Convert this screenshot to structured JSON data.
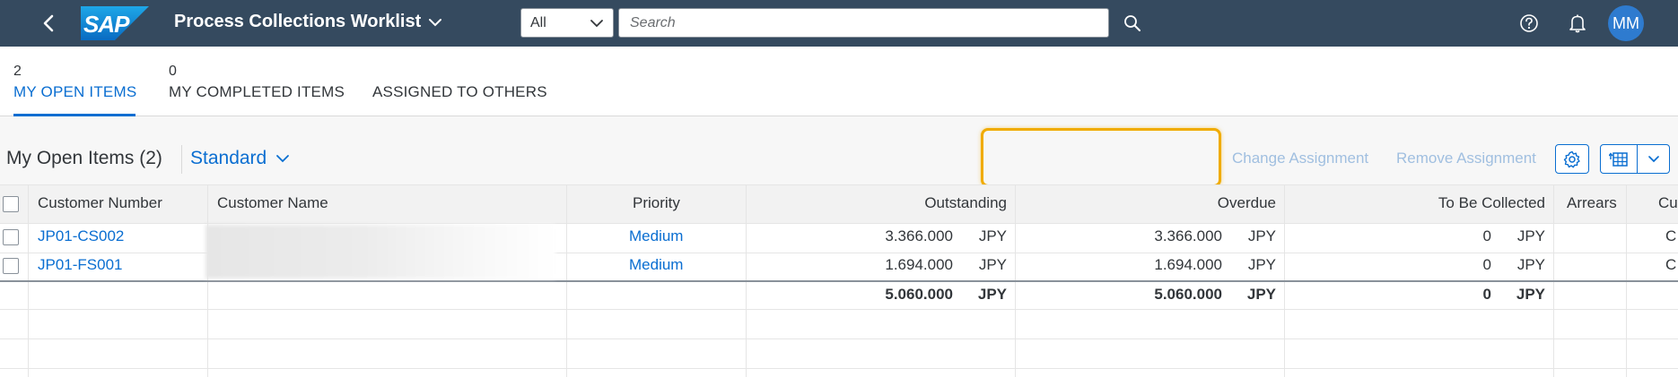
{
  "shell": {
    "logo_text": "SAP",
    "app_title": "Process Collections Worklist",
    "scope": "All",
    "search_placeholder": "Search",
    "avatar_initials": "MM",
    "colors": {
      "shell_bg": "#354a5f",
      "accent": "#0a6ed1",
      "avatar_bg": "#2e7bcf",
      "highlight": "#f0ab00"
    }
  },
  "tabs": [
    {
      "count": "2",
      "label": "MY OPEN ITEMS",
      "selected": true
    },
    {
      "count": "0",
      "label": "MY COMPLETED ITEMS",
      "selected": false
    },
    {
      "count": "",
      "label": "ASSIGNED TO OTHERS",
      "selected": false
    }
  ],
  "toolbar": {
    "title": "My Open Items (2)",
    "variant": "Standard",
    "change_assignment": "Change Assignment",
    "remove_assignment": "Remove Assignment",
    "settings_icon": "gear-icon",
    "export_icon": "export-spreadsheet-icon"
  },
  "table": {
    "columns": [
      "Customer Number",
      "Customer Name",
      "Priority",
      "Outstanding",
      "Overdue",
      "To Be Collected",
      "Arrears",
      "Cu"
    ],
    "rows": [
      {
        "customer_number": "JP01-CS002",
        "customer_name": "",
        "priority": "Medium",
        "outstanding": "3.366.000",
        "outstanding_cur": "JPY",
        "overdue": "3.366.000",
        "overdue_cur": "JPY",
        "to_be_collected": "0",
        "to_be_collected_cur": "JPY",
        "arrears": "",
        "cu": "C"
      },
      {
        "customer_number": "JP01-FS001",
        "customer_name": "",
        "priority": "Medium",
        "outstanding": "1.694.000",
        "outstanding_cur": "JPY",
        "overdue": "1.694.000",
        "overdue_cur": "JPY",
        "to_be_collected": "0",
        "to_be_collected_cur": "JPY",
        "arrears": "",
        "cu": "C"
      }
    ],
    "totals": {
      "outstanding": "5.060.000",
      "outstanding_cur": "JPY",
      "overdue": "5.060.000",
      "overdue_cur": "JPY",
      "to_be_collected": "0",
      "to_be_collected_cur": "JPY"
    }
  }
}
